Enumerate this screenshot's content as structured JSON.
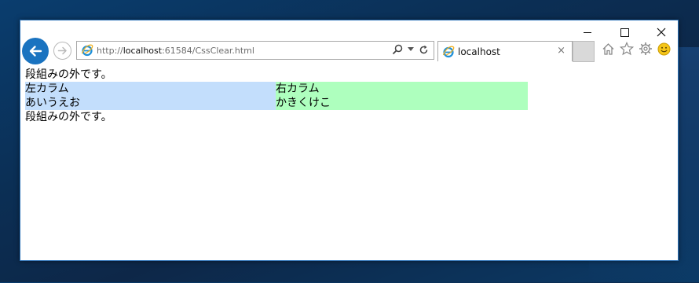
{
  "browser": {
    "url_prefix": "http://",
    "url_host": "localhost",
    "url_rest": ":61584/CssClear.html",
    "tab_title": "localhost",
    "tab_close": "×"
  },
  "page": {
    "outside_text_top": "段組みの外です。",
    "left_column": {
      "title": "左カラム",
      "text": "あいうえお",
      "background": "#c3defc"
    },
    "right_column": {
      "title": "右カラム",
      "text": "かきくけこ",
      "background": "#aeffbe"
    },
    "outside_text_bottom": "段組みの外です。"
  },
  "icons": {
    "back": "back-arrow-icon",
    "forward": "forward-arrow-icon",
    "search": "search-icon",
    "refresh": "refresh-icon",
    "home": "home-icon",
    "favorites": "star-icon",
    "settings": "gear-icon",
    "feedback": "smiley-icon"
  },
  "colors": {
    "accent": "#1a73c0",
    "window_border": "#2b72b8"
  }
}
